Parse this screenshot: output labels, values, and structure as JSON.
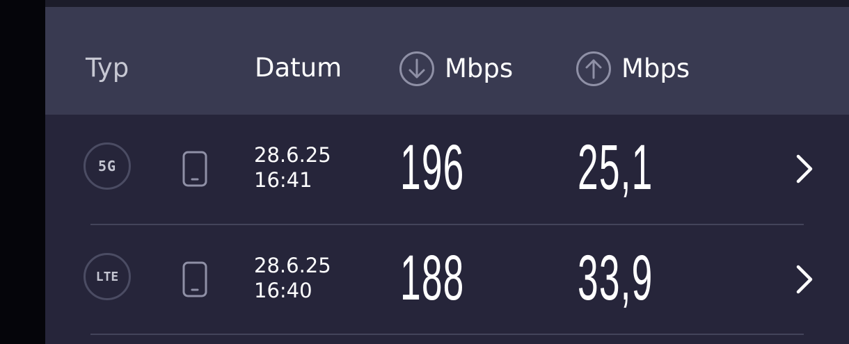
{
  "header": {
    "type_label": "Typ",
    "date_label": "Datum",
    "download_unit": "Mbps",
    "upload_unit": "Mbps",
    "download_icon": "arrow-down-circle-icon",
    "upload_icon": "arrow-up-circle-icon"
  },
  "results": [
    {
      "network_type": "5G",
      "device_icon": "smartphone-icon",
      "date": "28.6.25",
      "time": "16:41",
      "download": "196",
      "upload": "25,1",
      "chevron_icon": "chevron-right-icon"
    },
    {
      "network_type": "LTE",
      "device_icon": "smartphone-icon",
      "date": "28.6.25",
      "time": "16:40",
      "download": "188",
      "upload": "33,9",
      "chevron_icon": "chevron-right-icon"
    }
  ],
  "colors": {
    "background": "#26253a",
    "header_background": "#393a51",
    "text": "#ffffff",
    "muted": "#8f90a6",
    "divider": "#43445a"
  }
}
